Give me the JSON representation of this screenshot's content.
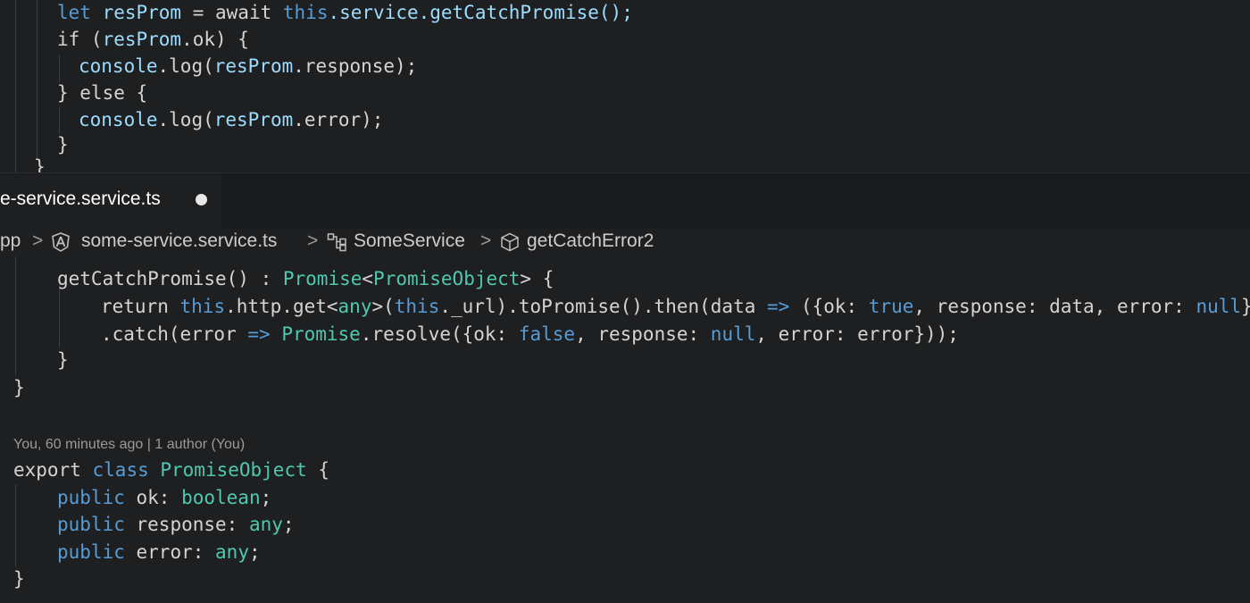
{
  "editor_top": {
    "lines": [
      [
        {
          "t": "let ",
          "c": "ctl"
        },
        {
          "t": "resProm",
          "c": "var"
        },
        {
          "t": " = await ",
          "c": "pl"
        },
        {
          "t": "this",
          "c": "ctl"
        },
        {
          "t": ".service.getCatchPromise();",
          "c": "var"
        }
      ],
      [
        {
          "t": "if (",
          "c": "pl"
        },
        {
          "t": "resProm",
          "c": "var"
        },
        {
          "t": ".ok) {",
          "c": "pl"
        }
      ],
      [
        {
          "t": "console",
          "c": "var"
        },
        {
          "t": ".log(",
          "c": "pl"
        },
        {
          "t": "resProm",
          "c": "var"
        },
        {
          "t": ".response);",
          "c": "pl"
        }
      ],
      [
        {
          "t": "} else {",
          "c": "pl"
        }
      ],
      [
        {
          "t": "console",
          "c": "var"
        },
        {
          "t": ".log(",
          "c": "pl"
        },
        {
          "t": "resProm",
          "c": "var"
        },
        {
          "t": ".error);",
          "c": "pl"
        }
      ],
      [
        {
          "t": "}",
          "c": "pl"
        }
      ],
      [
        {
          "t": "}",
          "c": "pl"
        }
      ]
    ]
  },
  "tab": {
    "title": "e-service.service.ts",
    "dirty_indicator": "●"
  },
  "breadcrumb": {
    "root": "pp",
    "file": "some-service.service.ts",
    "class": "SomeService",
    "method": "getCatchError2",
    "separator": ">"
  },
  "editor_bottom": {
    "lines_before": [
      [
        {
          "t": "getCatchPromise() : ",
          "c": "pl"
        },
        {
          "t": "Promise",
          "c": "ty"
        },
        {
          "t": "<",
          "c": "pl"
        },
        {
          "t": "PromiseObject",
          "c": "ty"
        },
        {
          "t": "> {",
          "c": "pl"
        }
      ],
      [
        {
          "t": "return ",
          "c": "pl"
        },
        {
          "t": "this",
          "c": "cn"
        },
        {
          "t": ".http.get<",
          "c": "pl"
        },
        {
          "t": "any",
          "c": "ty"
        },
        {
          "t": ">(",
          "c": "pl"
        },
        {
          "t": "this",
          "c": "cn"
        },
        {
          "t": "._url).toPromise().then(data ",
          "c": "pl"
        },
        {
          "t": "=>",
          "c": "cn"
        },
        {
          "t": " ({ok: ",
          "c": "pl"
        },
        {
          "t": "true",
          "c": "cn"
        },
        {
          "t": ", response: data, error: ",
          "c": "pl"
        },
        {
          "t": "null",
          "c": "cn"
        },
        {
          "t": "}))",
          "c": "pl"
        }
      ],
      [
        {
          "t": ".catch(error ",
          "c": "pl"
        },
        {
          "t": "=>",
          "c": "cn"
        },
        {
          "t": " ",
          "c": "pl"
        },
        {
          "t": "Promise",
          "c": "ty"
        },
        {
          "t": ".resolve({ok: ",
          "c": "pl"
        },
        {
          "t": "false",
          "c": "cn"
        },
        {
          "t": ", response: ",
          "c": "pl"
        },
        {
          "t": "null",
          "c": "cn"
        },
        {
          "t": ", error: error}));",
          "c": "pl"
        }
      ],
      [
        {
          "t": "}",
          "c": "pl"
        }
      ],
      [
        {
          "t": "}",
          "c": "pl"
        }
      ]
    ],
    "codelens": "You, 60 minutes ago | 1 author (You)",
    "lines_after": [
      [
        {
          "t": "export ",
          "c": "pl"
        },
        {
          "t": "class ",
          "c": "ctl"
        },
        {
          "t": "PromiseObject",
          "c": "ty"
        },
        {
          "t": " {",
          "c": "pl"
        }
      ],
      [
        {
          "t": "public ",
          "c": "ctl"
        },
        {
          "t": "ok: ",
          "c": "pl"
        },
        {
          "t": "boolean",
          "c": "ty"
        },
        {
          "t": ";",
          "c": "pl"
        }
      ],
      [
        {
          "t": "public ",
          "c": "ctl"
        },
        {
          "t": "response: ",
          "c": "pl"
        },
        {
          "t": "any",
          "c": "ty"
        },
        {
          "t": ";",
          "c": "pl"
        }
      ],
      [
        {
          "t": "public ",
          "c": "ctl"
        },
        {
          "t": "error: ",
          "c": "pl"
        },
        {
          "t": "any",
          "c": "ty"
        },
        {
          "t": ";",
          "c": "pl"
        }
      ],
      [
        {
          "t": "}",
          "c": "pl"
        }
      ]
    ]
  }
}
